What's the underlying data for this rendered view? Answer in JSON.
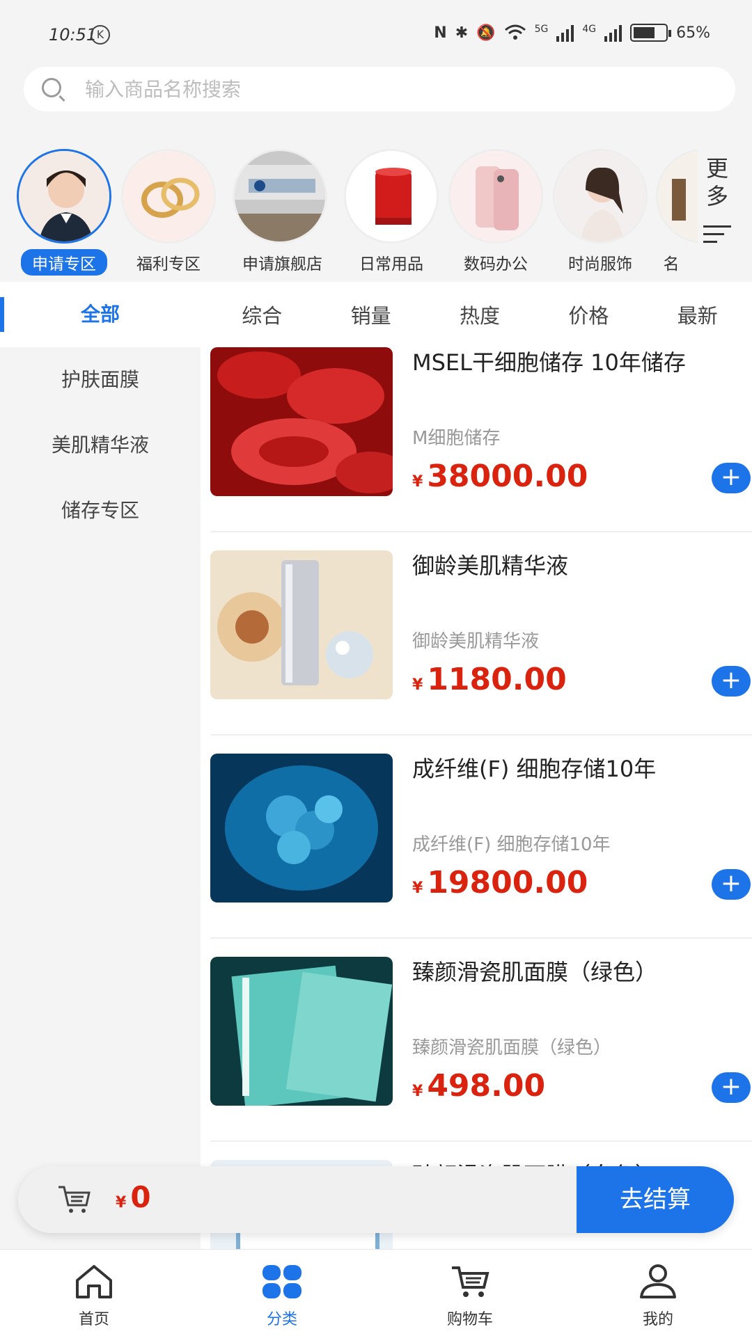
{
  "status_bar": {
    "time": "10:51",
    "k_badge": "K",
    "net1": "5G",
    "net2": "4G",
    "battery": "65%"
  },
  "search": {
    "placeholder": "输入商品名称搜索"
  },
  "categories": [
    {
      "label": "申请专区",
      "icon": "customer-service-avatar"
    },
    {
      "label": "福利专区",
      "icon": "gold-rings"
    },
    {
      "label": "申请旗舰店",
      "icon": "company-reception"
    },
    {
      "label": "日常用品",
      "icon": "red-speaker"
    },
    {
      "label": "数码办公",
      "icon": "phone"
    },
    {
      "label": "时尚服饰",
      "icon": "model-portrait"
    },
    {
      "label": "名",
      "icon": "partial-item"
    }
  ],
  "more": {
    "line1": "更",
    "line2": "多"
  },
  "sidebar": {
    "items": [
      "全部",
      "护肤面膜",
      "美肌精华液",
      "储存专区"
    ]
  },
  "sorts": [
    "综合",
    "销量",
    "热度",
    "价格",
    "最新"
  ],
  "products": [
    {
      "name": "MSEL干细胞储存 10年储存",
      "sub": "M细胞储存",
      "currency": "¥",
      "price": "38000.00"
    },
    {
      "name": "御龄美肌精华液",
      "sub": "御龄美肌精华液",
      "currency": "¥",
      "price": "1180.00"
    },
    {
      "name": "成纤维(F) 细胞存储10年",
      "sub": "成纤维(F) 细胞存储10年",
      "currency": "¥",
      "price": "19800.00"
    },
    {
      "name": "臻颜滑瓷肌面膜（绿色）",
      "sub": "臻颜滑瓷肌面膜（绿色）",
      "currency": "¥",
      "price": "498.00"
    },
    {
      "name": "臻颜滑瓷肌面膜（白色）",
      "sub": "",
      "currency": "¥",
      "price": ""
    }
  ],
  "cart": {
    "currency": "¥",
    "total": "0",
    "checkout": "去结算"
  },
  "tabbar": [
    {
      "label": "首页",
      "icon": "home-icon"
    },
    {
      "label": "分类",
      "icon": "category-icon"
    },
    {
      "label": "购物车",
      "icon": "cart-icon"
    },
    {
      "label": "我的",
      "icon": "user-icon"
    }
  ],
  "colors": {
    "accent": "#1d73e8",
    "price": "#d9230f"
  }
}
